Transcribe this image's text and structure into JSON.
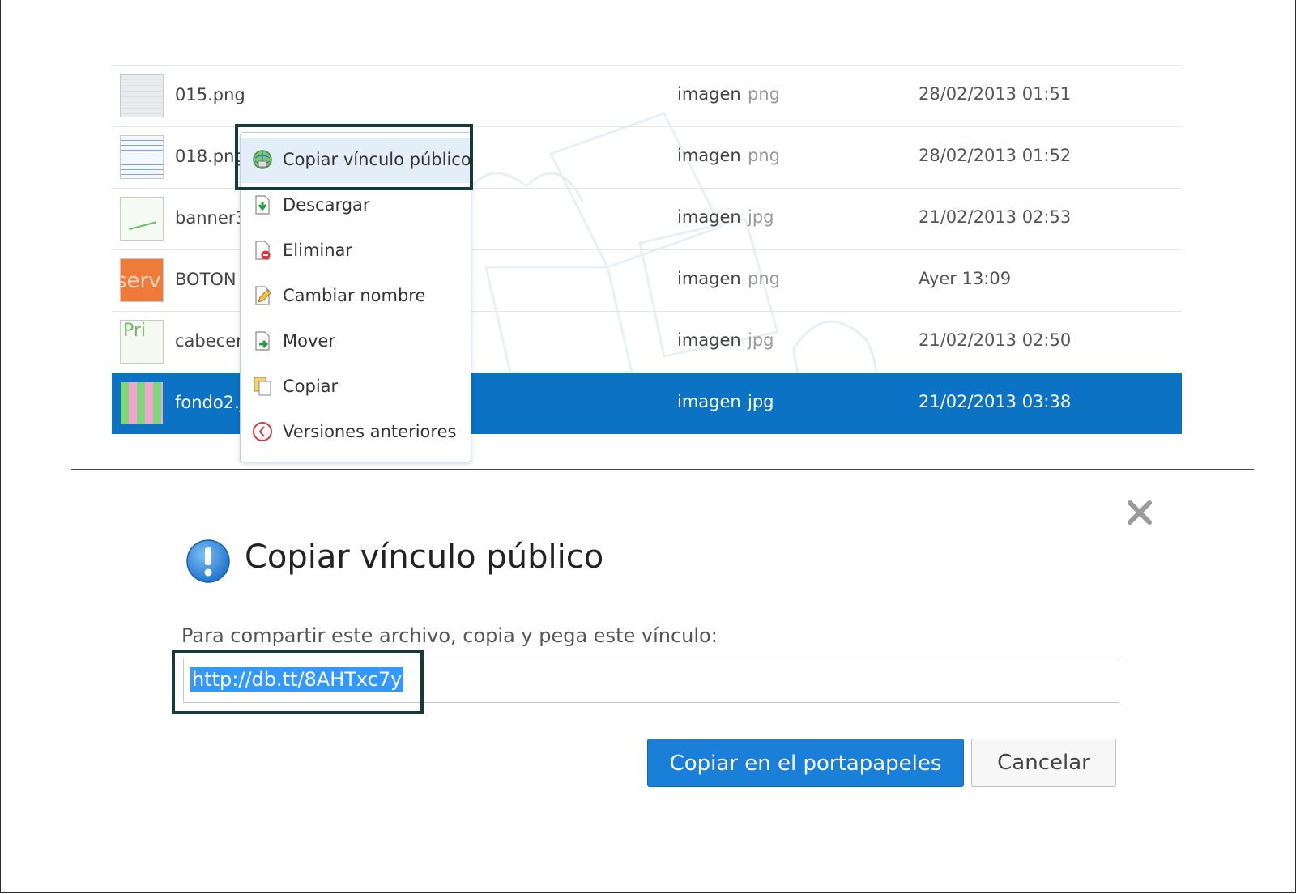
{
  "files": [
    {
      "name": "015.png",
      "type": "imagen",
      "ext": "png",
      "date": "28/02/2013 01:51"
    },
    {
      "name": "018.png",
      "type": "imagen",
      "ext": "png",
      "date": "28/02/2013 01:52"
    },
    {
      "name": "banner3",
      "type": "imagen",
      "ext": "jpg",
      "date": "21/02/2013 02:53"
    },
    {
      "name": "BOTON",
      "type": "imagen",
      "ext": "png",
      "date": "Ayer 13:09",
      "thumb_text": "serv"
    },
    {
      "name": "cabecera",
      "type": "imagen",
      "ext": "jpg",
      "date": "21/02/2013 02:50",
      "thumb_text": "Pri"
    },
    {
      "name": "fondo2.jpg",
      "type": "imagen",
      "ext": "jpg",
      "date": "21/02/2013 03:38",
      "selected": true
    }
  ],
  "context_menu": {
    "items": [
      {
        "label": "Copiar vínculo público",
        "icon": "globe-link-icon"
      },
      {
        "label": "Descargar",
        "icon": "download-icon"
      },
      {
        "label": "Eliminar",
        "icon": "delete-icon"
      },
      {
        "label": "Cambiar nombre",
        "icon": "rename-icon"
      },
      {
        "label": "Mover",
        "icon": "move-icon"
      },
      {
        "label": "Copiar",
        "icon": "copy-icon"
      },
      {
        "label": "Versiones anteriores",
        "icon": "history-icon"
      }
    ]
  },
  "dialog": {
    "title": "Copiar vínculo público",
    "prompt": "Para compartir este archivo, copia y pega este vínculo:",
    "url": "http://db.tt/8AHTxc7y",
    "primary_button": "Copiar en el portapapeles",
    "cancel_button": "Cancelar"
  },
  "colors": {
    "selection": "#0b72c4",
    "primary_button": "#1a7fd8",
    "highlight_box": "#163a37"
  }
}
